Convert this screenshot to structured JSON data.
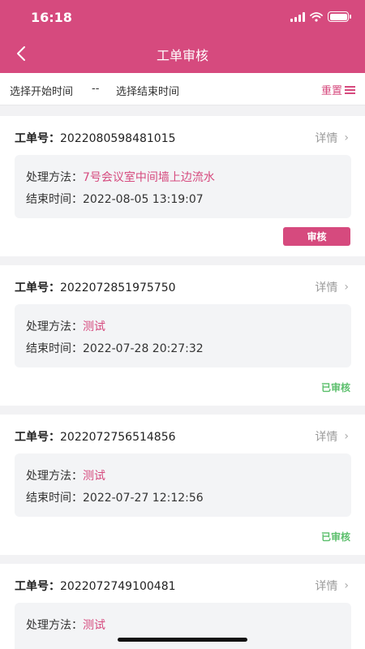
{
  "status_bar": {
    "time": "16:18"
  },
  "header": {
    "title": "工单审核"
  },
  "filter": {
    "start_placeholder": "选择开始时间",
    "separator": "--",
    "end_placeholder": "选择结束时间",
    "reset_label": "重置"
  },
  "labels": {
    "order_no": "工单号：",
    "detail": "详情",
    "method": "处理方法：",
    "end_time": "结束时间："
  },
  "orders": [
    {
      "order_no": "2022080598481015",
      "method": "7号会议室中间墙上边流水",
      "end_time": "2022-08-05 13:19:07",
      "action": "审核"
    },
    {
      "order_no": "2022072851975750",
      "method": "测试",
      "end_time": "2022-07-28 20:27:32",
      "status": "已审核"
    },
    {
      "order_no": "2022072756514856",
      "method": "测试",
      "end_time": "2022-07-27 12:12:56",
      "status": "已审核"
    },
    {
      "order_no": "2022072749100481",
      "method": "测试"
    }
  ],
  "colors": {
    "brand": "#d64a7e",
    "approved": "#5bbf6c"
  }
}
